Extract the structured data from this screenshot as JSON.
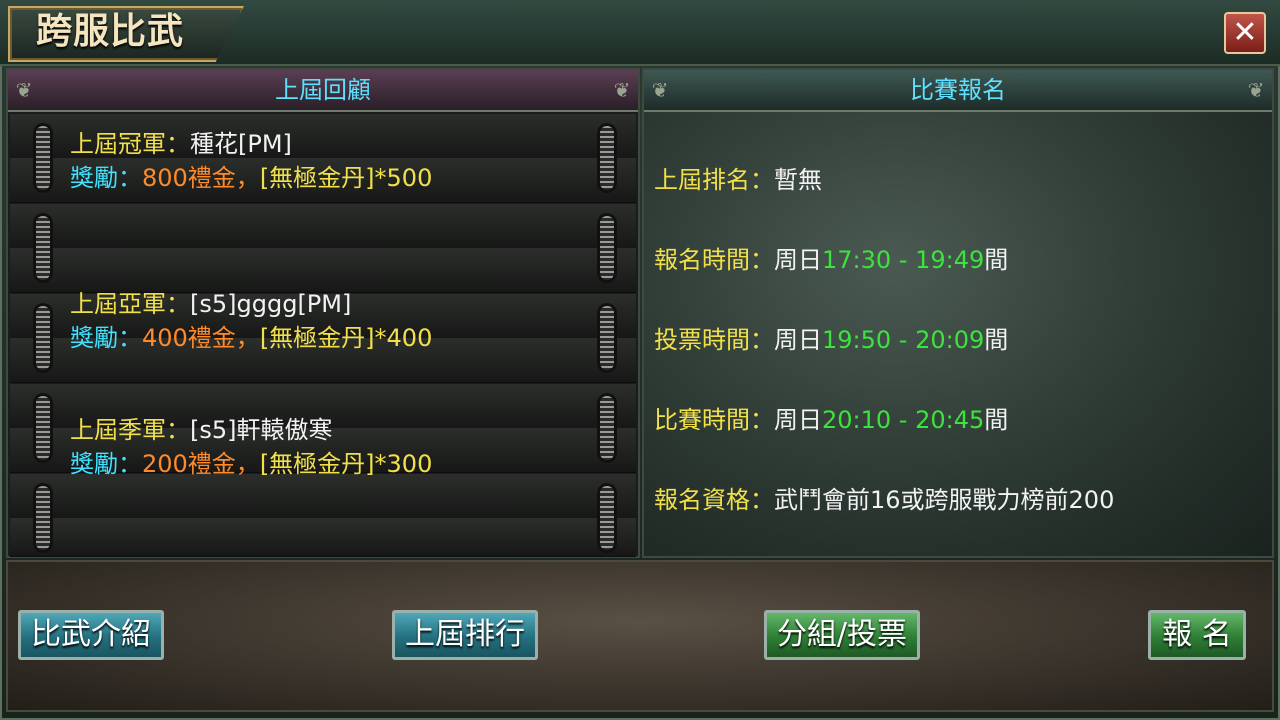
{
  "window": {
    "title": "跨服比武",
    "close_label": "✕"
  },
  "left_panel": {
    "header": "上屆回顧",
    "entries": [
      {
        "label": "上屆冠軍：",
        "name": "種花[PM]",
        "reward_label": "獎勵：",
        "reward_gold": "800禮金，",
        "reward_item": "[無極金丹]*500"
      },
      {
        "label": "上屆亞軍：",
        "name": "[s5]gggg[PM]",
        "reward_label": "獎勵：",
        "reward_gold": "400禮金，",
        "reward_item": "[無極金丹]*400"
      },
      {
        "label": "上屆季軍：",
        "name": "[s5]軒轅傲寒",
        "reward_label": "獎勵：",
        "reward_gold": "200禮金，",
        "reward_item": "[無極金丹]*300"
      }
    ]
  },
  "right_panel": {
    "header": "比賽報名",
    "rank": {
      "label": "上屆排名：",
      "value": "暫無"
    },
    "signup_time": {
      "label": "報名時間：",
      "prefix": "周日",
      "range": "17:30 - 19:49",
      "suffix": "間"
    },
    "vote_time": {
      "label": "投票時間：",
      "prefix": "周日",
      "range": "19:50 - 20:09",
      "suffix": "間"
    },
    "match_time": {
      "label": "比賽時間：",
      "prefix": "周日",
      "range": "20:10 - 20:45",
      "suffix": "間"
    },
    "eligibility": {
      "label": "報名資格：",
      "value": "武鬥會前16或跨服戰力榜前200"
    }
  },
  "buttons": {
    "intro": "比武介紹",
    "last_ranking": "上屆排行",
    "group_vote": "分組/投票",
    "signup": "報 名"
  },
  "colors": {
    "label_yellow": "#f2e04a",
    "label_cyan": "#41e1ff",
    "reward_orange": "#ff8a2a",
    "time_green": "#3de33d",
    "header_cyan": "#5fe0ff"
  }
}
